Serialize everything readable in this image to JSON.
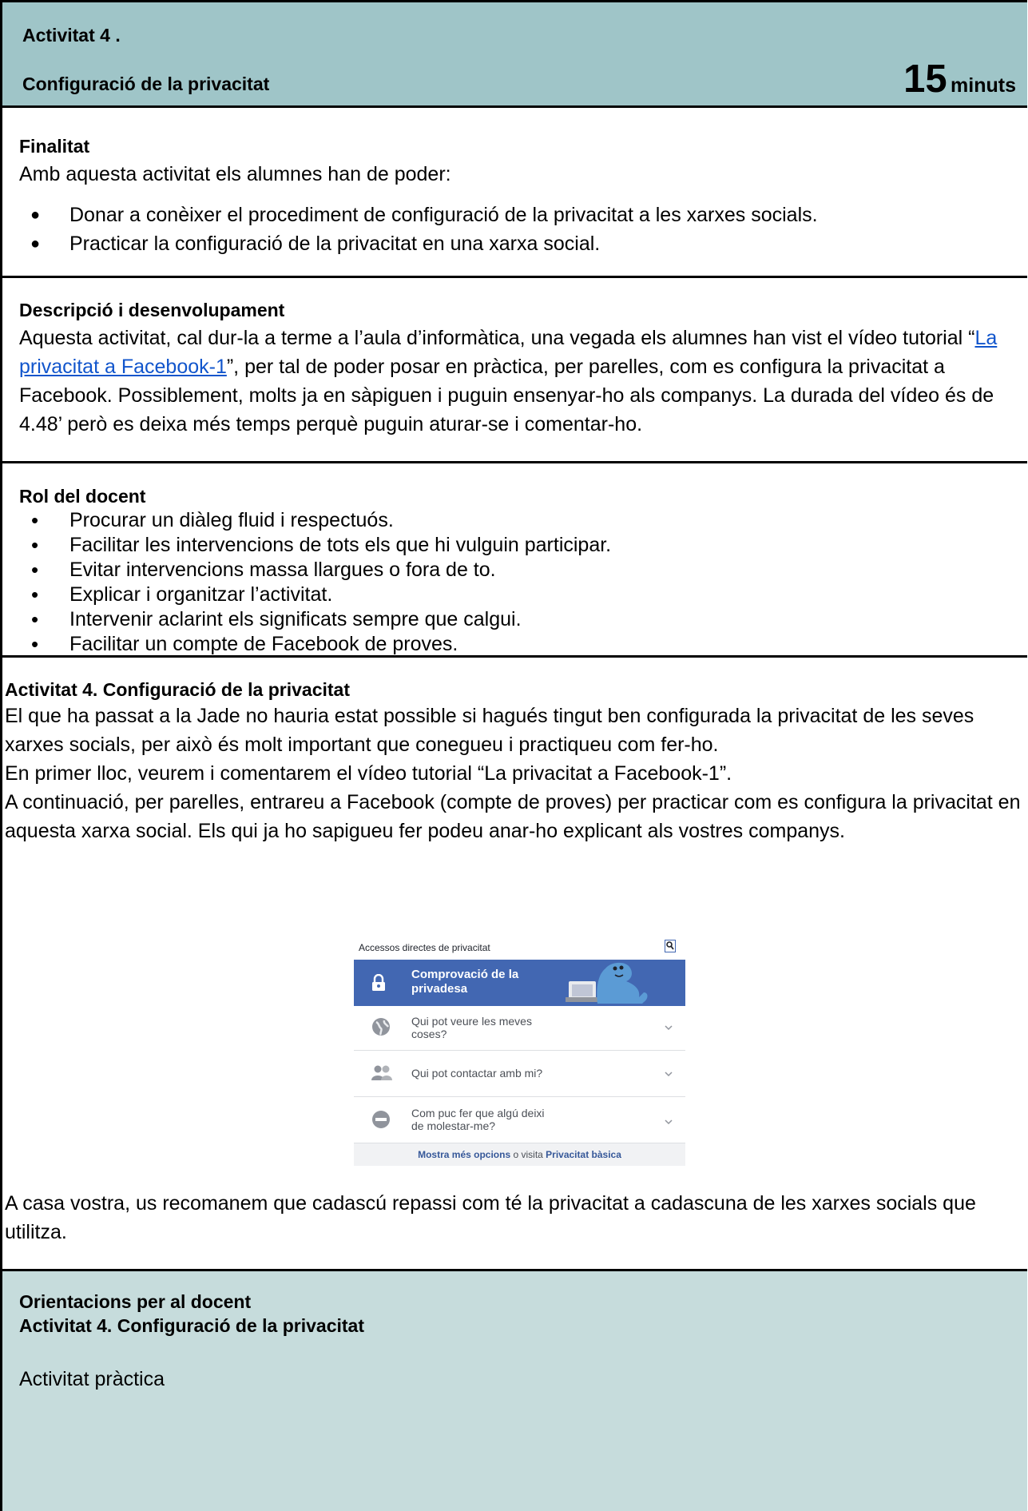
{
  "header": {
    "activity": "Activitat 4 .",
    "title": "Configuració de la privacitat",
    "duration_number": "15",
    "duration_unit": "minuts"
  },
  "finalitat": {
    "title": "Finalitat",
    "intro": "Amb aquesta activitat els alumnes han de poder:",
    "items": [
      "Donar a conèixer el procediment de configuració de la privacitat a les xarxes socials.",
      "Practicar la configuració de la privacitat en una xarxa social."
    ]
  },
  "descripcio": {
    "title": "Descripció i desenvolupament",
    "text_before": "Aquesta activitat, cal dur-la a terme a l’aula d’informàtica, una vegada els alumnes han vist el vídeo tutorial “",
    "link": "La privacitat a Facebook-1",
    "text_after": "”, per tal de poder posar en pràctica, per parelles, com es configura la privacitat a Facebook. Possiblement, molts ja en sàpiguen i puguin ensenyar-ho als companys. La durada del vídeo és de 4.48’ però es deixa més temps perquè puguin aturar-se i comentar-ho."
  },
  "rol": {
    "title": "Rol del docent",
    "items": [
      "Procurar un diàleg fluid i respectuós.",
      "Facilitar les intervencions de tots els que hi vulguin participar.",
      "Evitar intervencions massa llargues o fora de to.",
      "Explicar i organitzar l’activitat.",
      "Intervenir aclarint els significats sempre que calgui.",
      "Facilitar un compte de Facebook de proves."
    ]
  },
  "activitat": {
    "title": "Activitat 4. Configuració de la privacitat",
    "paragraphs": [
      "El que ha passat a la Jade no hauria estat possible si hagués tingut ben configurada la privacitat de les seves xarxes socials, per això és molt important que conegueu i practiqueu com fer-ho.",
      "En primer lloc,  veurem i comentarem el vídeo tutorial “La privacitat a Facebook-1”.",
      "A continuació, per parelles, entrareu a Facebook (compte de proves) per practicar com es configura la privacitat en aquesta xarxa social. Els qui ja ho sapigueu fer podeu anar-ho explicant als vostres companys."
    ],
    "closing": "A casa vostra, us recomanem que cadascú repassi com té la privacitat a cadascuna de les xarxes socials que utilitza."
  },
  "widget": {
    "title": "Accessos directes de privacitat",
    "band_line1": "Comprovació de la",
    "band_line2": "privadesa",
    "rows": [
      {
        "line1": "Qui pot veure les meves",
        "line2": "coses?",
        "icon": "globe-icon"
      },
      {
        "line1": "Qui pot contactar amb mi?",
        "line2": "",
        "icon": "people-icon"
      },
      {
        "line1": "Com puc fer que algú deixi",
        "line2": "de molestar-me?",
        "icon": "block-icon"
      }
    ],
    "footer_bold1": "Mostra més opcions",
    "footer_mid": " o visita ",
    "footer_bold2": "Privacitat bàsica",
    "colors": {
      "band": "#4267b2",
      "mascot": "#5b9bd5"
    }
  },
  "orientacions": {
    "title1": "Orientacions per al docent",
    "title2": "Activitat 4. Configuració de la privacitat",
    "text": "Activitat pràctica"
  },
  "colors": {
    "header_bg": "#9fc5c8",
    "orient_bg": "#c6dcdc",
    "link": "#1155cc"
  }
}
